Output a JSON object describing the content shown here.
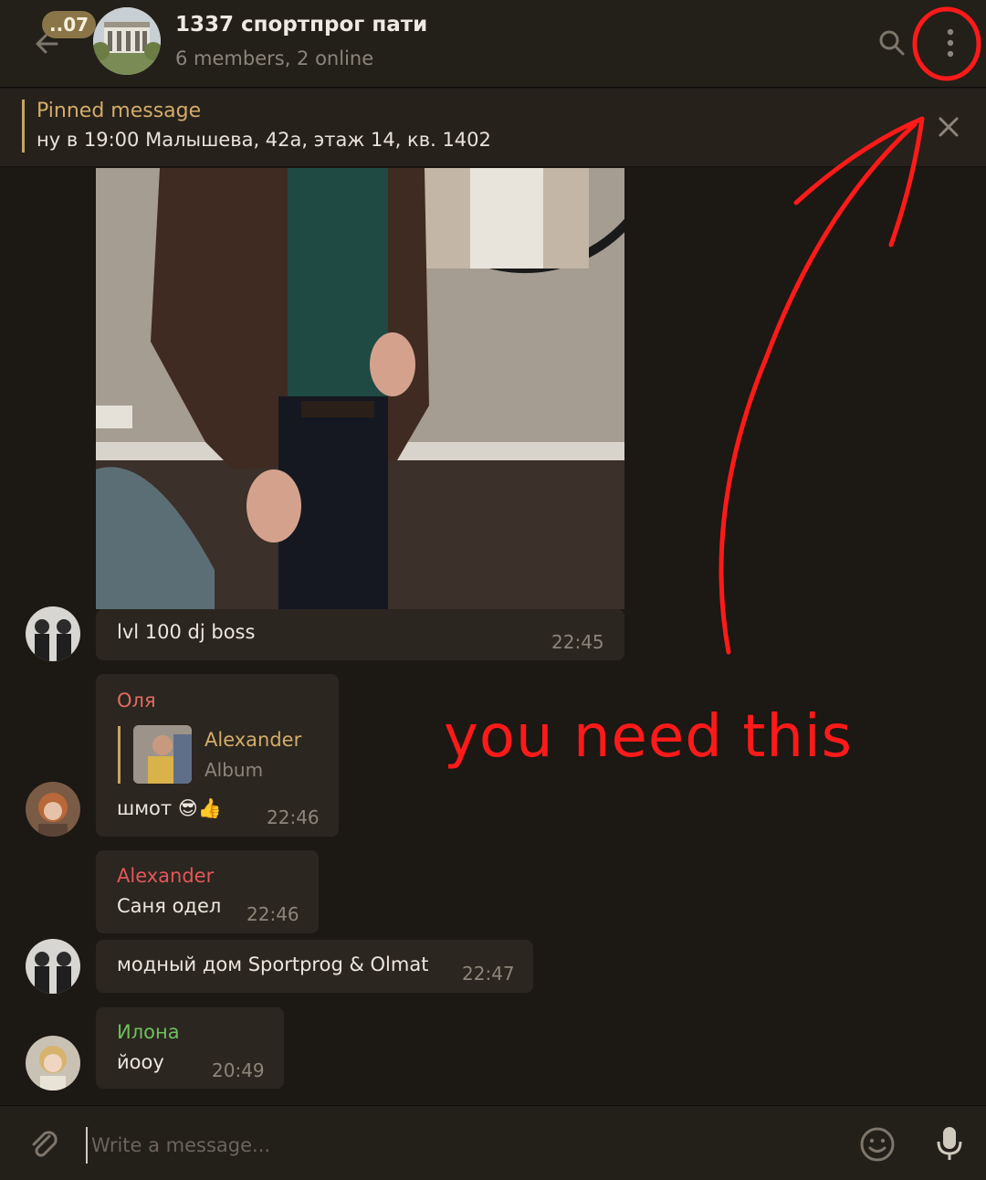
{
  "header": {
    "unread_badge": "..07",
    "title": "1337 спортпрог пати",
    "subtitle": "6 members, 2 online"
  },
  "pinned": {
    "title": "Pinned message",
    "text": "ну в 19:00 Малышева, 42а, этаж 14, кв. 1402"
  },
  "messages": [
    {
      "text": "lvl 100 dj boss",
      "time": "22:45"
    },
    {
      "sender": "Оля",
      "reply": {
        "name": "Alexander",
        "subtitle": "Album"
      },
      "text": "шмот 😎👍",
      "time": "22:46"
    },
    {
      "sender": "Alexander",
      "text": "Саня одел",
      "time": "22:46"
    },
    {
      "text": "модный дом Sportprog & Olmat",
      "time": "22:47"
    },
    {
      "sender": "Илона",
      "text": "йооу",
      "time": "20:49"
    }
  ],
  "colors": {
    "sender_olya": "#e06c62",
    "sender_alexander": "#e2575a",
    "sender_ilona": "#6fbf5f",
    "accent": "#c9a364",
    "annotation": "#ff1a1a"
  },
  "composer": {
    "placeholder": "Write a message..."
  },
  "annotation": {
    "text": "you need this"
  },
  "icons": {
    "back": "arrow-left-icon",
    "search": "search-icon",
    "menu": "more-vertical-icon",
    "close": "close-icon",
    "attach": "paperclip-icon",
    "emoji": "smile-icon",
    "mic": "microphone-icon"
  }
}
